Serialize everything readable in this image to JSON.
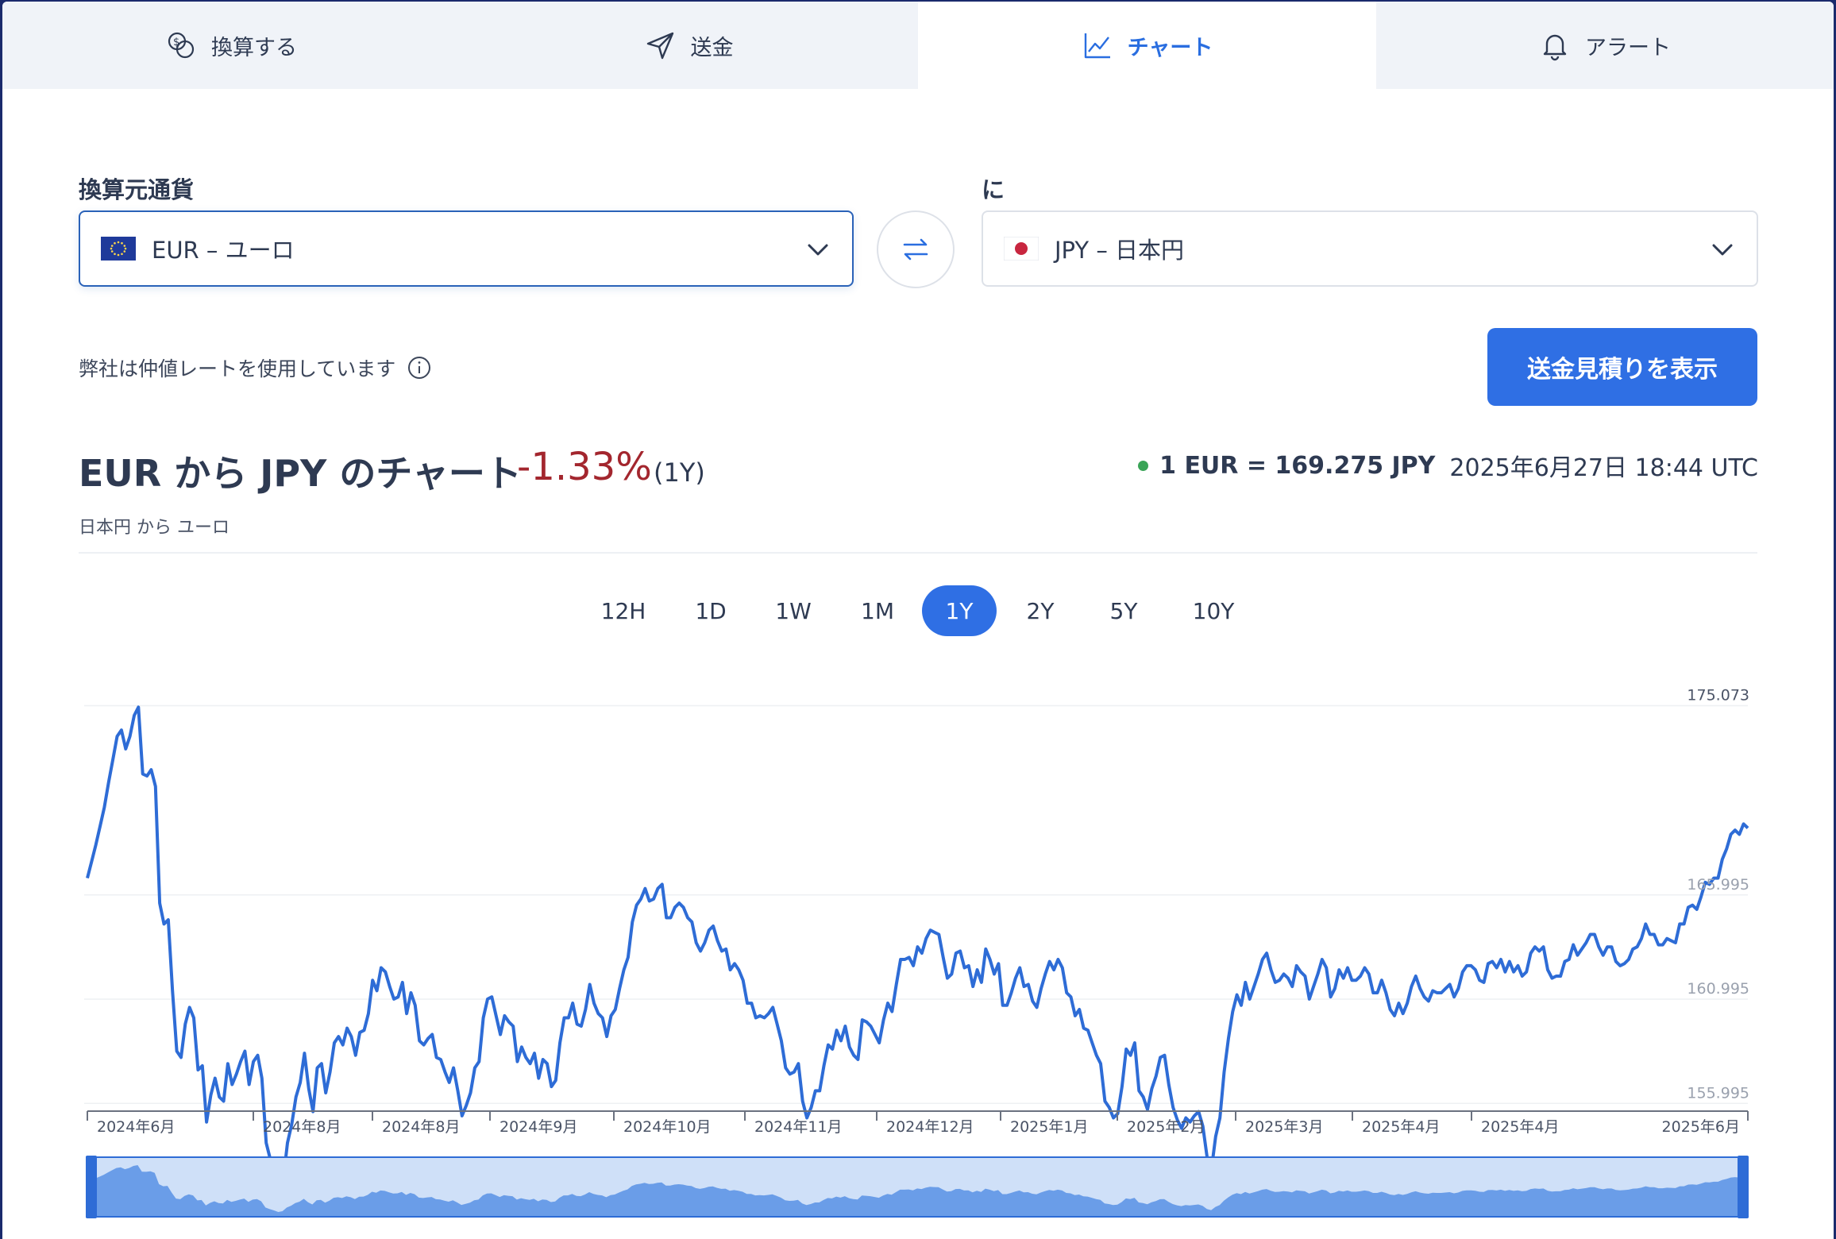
{
  "tabs": [
    {
      "label": "換算する",
      "icon": "coins-icon"
    },
    {
      "label": "送金",
      "icon": "send-icon"
    },
    {
      "label": "チャート",
      "icon": "chart-icon",
      "active": true
    },
    {
      "label": "アラート",
      "icon": "bell-icon"
    }
  ],
  "converter": {
    "from_label": "換算元通貨",
    "from_value": "EUR – ユーロ",
    "to_label": "に",
    "to_value": "JPY – 日本円",
    "midmarket_note": "弊社は仲値レートを使用しています",
    "quote_button": "送金見積りを表示"
  },
  "chart_header": {
    "title": "EUR から JPY のチャート",
    "change": "-1.33%",
    "period": "(1Y)",
    "subtitle": "日本円 から ユーロ",
    "rate": "1 EUR = 169.275 JPY",
    "timestamp": "2025年6月27日 18:44 UTC"
  },
  "periods": [
    "12H",
    "1D",
    "1W",
    "1M",
    "1Y",
    "2Y",
    "5Y",
    "10Y"
  ],
  "active_period": "1Y",
  "colors": {
    "accent": "#2f6fe4",
    "line": "#2e6cd6",
    "negative": "#a3262e",
    "live_dot": "#3aa457"
  },
  "chart_data": {
    "type": "line",
    "series": [
      {
        "values": [
          166.8,
          167.6,
          168.4,
          169.3,
          170.2,
          171.4,
          172.5,
          173.6,
          173.9,
          173.0,
          173.6,
          174.6,
          175.0,
          171.8,
          171.7,
          172.0,
          171.2,
          165.6,
          164.6,
          164.8,
          161.4,
          158.5,
          158.2,
          159.8,
          160.6,
          160.1,
          157.6,
          157.8,
          155.1,
          156.4,
          157.2,
          156.3,
          156.1,
          157.9,
          156.9,
          157.4,
          158.0,
          158.5,
          156.9,
          158.0,
          158.3,
          157.2,
          154.1,
          153.3,
          152.7,
          151.9,
          152.3,
          154.1,
          155.0,
          156.3,
          157.0,
          158.4,
          156.7,
          155.6,
          157.7,
          157.9,
          156.5,
          157.5,
          158.9,
          159.2,
          158.8,
          159.6,
          159.2,
          158.3,
          159.4,
          159.5,
          160.3,
          161.9,
          161.4,
          162.5,
          162.3,
          161.6,
          161.0,
          161.1,
          161.8,
          160.3,
          161.3,
          160.7,
          159.0,
          158.8,
          159.1,
          159.3,
          158.2,
          158.1,
          157.5,
          157.0,
          157.7,
          156.6,
          155.4,
          155.9,
          156.5,
          157.7,
          158.0,
          160.1,
          161.0,
          161.1,
          160.2,
          159.3,
          160.2,
          159.9,
          159.7,
          158.0,
          158.7,
          158.2,
          157.9,
          158.4,
          157.2,
          158.1,
          157.9,
          156.8,
          157.1,
          158.9,
          160.1,
          160.1,
          160.8,
          159.8,
          159.7,
          160.5,
          161.7,
          160.8,
          160.3,
          160.1,
          159.2,
          160.2,
          160.5,
          161.5,
          162.4,
          163.0,
          164.7,
          165.5,
          165.8,
          166.3,
          165.7,
          165.8,
          166.3,
          166.5,
          164.9,
          164.9,
          165.4,
          165.6,
          165.4,
          164.9,
          164.7,
          163.7,
          163.3,
          163.7,
          164.3,
          164.5,
          163.8,
          163.3,
          163.4,
          162.4,
          162.7,
          162.4,
          161.9,
          160.8,
          160.8,
          160.1,
          160.2,
          160.1,
          160.3,
          160.6,
          159.8,
          159.0,
          157.7,
          157.4,
          157.5,
          157.9,
          156.1,
          155.3,
          155.8,
          156.6,
          156.6,
          157.8,
          158.8,
          158.6,
          159.5,
          159.0,
          159.7,
          158.7,
          158.3,
          158.1,
          160.0,
          159.9,
          159.7,
          159.3,
          158.9,
          160.0,
          160.8,
          160.4,
          161.7,
          162.9,
          162.9,
          163.0,
          162.6,
          163.5,
          163.2,
          163.9,
          164.3,
          164.2,
          164.1,
          163.0,
          162.0,
          162.2,
          163.2,
          163.3,
          162.5,
          162.6,
          161.6,
          162.4,
          161.8,
          163.4,
          162.9,
          162.2,
          162.7,
          160.7,
          160.7,
          161.3,
          162.0,
          162.5,
          161.6,
          161.7,
          160.9,
          160.6,
          161.5,
          162.2,
          162.8,
          162.4,
          162.9,
          162.5,
          161.3,
          161.1,
          160.2,
          160.5,
          159.6,
          159.5,
          158.9,
          158.3,
          157.9,
          156.1,
          155.8,
          155.3,
          155.5,
          156.8,
          158.6,
          158.3,
          158.9,
          156.6,
          156.3,
          155.7,
          156.7,
          157.3,
          158.2,
          158.3,
          156.9,
          155.8,
          155.2,
          154.8,
          155.3,
          155.1,
          155.4,
          155.6,
          154.9,
          153.4,
          152.8,
          154.4,
          155.3,
          157.5,
          159.1,
          160.4,
          161.2,
          160.7,
          161.8,
          161.0,
          161.6,
          162.2,
          162.9,
          163.2,
          162.4,
          161.8,
          161.9,
          162.2,
          162.0,
          161.6,
          162.6,
          162.3,
          162.1,
          161.0,
          161.6,
          162.2,
          162.9,
          162.5,
          161.1,
          161.5,
          162.4,
          162.0,
          162.5,
          161.9,
          161.9,
          162.1,
          162.5,
          162.2,
          161.3,
          161.3,
          161.9,
          161.3,
          160.5,
          160.2,
          160.8,
          160.3,
          160.8,
          161.6,
          162.1,
          161.5,
          161.1,
          160.9,
          161.4,
          161.3,
          161.3,
          161.5,
          161.7,
          161.1,
          161.5,
          162.3,
          162.6,
          162.6,
          162.4,
          161.9,
          161.8,
          162.7,
          162.8,
          162.5,
          162.9,
          162.3,
          162.8,
          162.3,
          162.6,
          162.1,
          162.3,
          163.2,
          163.5,
          163.3,
          163.5,
          162.4,
          162.0,
          162.1,
          162.1,
          162.8,
          162.9,
          163.6,
          163.1,
          163.4,
          163.7,
          164.1,
          164.1,
          163.5,
          163.1,
          163.5,
          163.5,
          162.8,
          162.6,
          162.7,
          162.9,
          163.4,
          163.5,
          163.9,
          164.6,
          164.1,
          164.1,
          163.6,
          163.6,
          163.9,
          163.8,
          163.7,
          164.6,
          164.6,
          165.4,
          165.5,
          165.3,
          165.9,
          166.6,
          166.5,
          166.8,
          166.8,
          167.7,
          168.2,
          168.9,
          169.1,
          168.9,
          169.4,
          169.2
        ],
        "color": "#2e6cd6"
      }
    ],
    "x_tick_labels": [
      "2024年6月",
      "2024年8月",
      "2024年8月",
      "2024年9月",
      "2024年10月",
      "2024年11月",
      "2024年12月",
      "2025年1月",
      "2025年2月",
      "2025年3月",
      "2025年4月",
      "2025年4月",
      "2025年6月"
    ],
    "y_tick_labels": [
      "175.073",
      "165.995",
      "160.995",
      "155.995"
    ],
    "y_ticks": [
      175.073,
      165.995,
      160.995,
      155.995
    ],
    "ylim": [
      155.7,
      175.7
    ],
    "grid": true
  }
}
